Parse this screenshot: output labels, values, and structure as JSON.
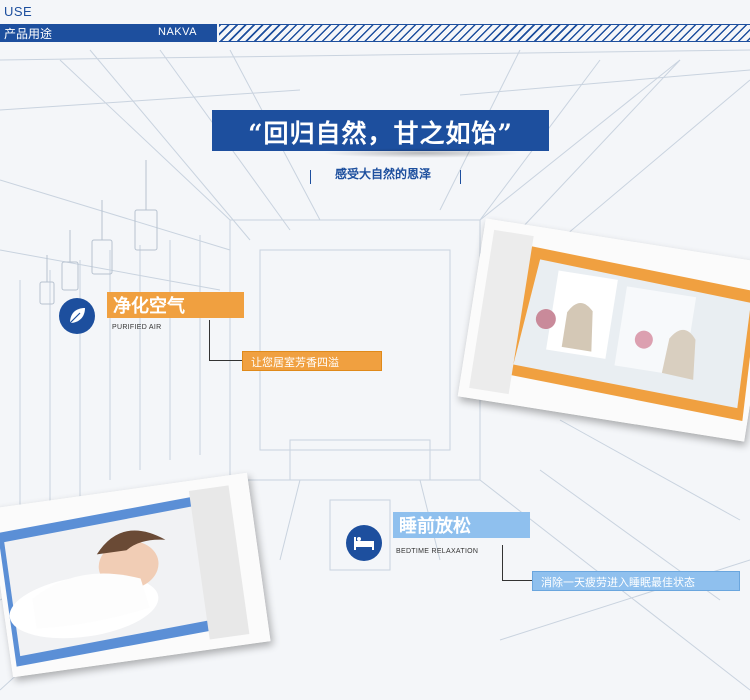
{
  "header": {
    "use_label": "USE",
    "cn_label": "产品用途",
    "brand": "NAKVA"
  },
  "slogan": {
    "text": "“回归自然，甘之如饴”",
    "subtitle": "感受大自然的恩泽"
  },
  "features": [
    {
      "title": "净化空气",
      "english": "PURIFIED AIR",
      "description": "让您居室芳香四溢",
      "icon": "leaf-icon",
      "accent": "#f0a040"
    },
    {
      "title": "睡前放松",
      "english": "BEDTIME RELAXATION",
      "description": "消除一天疲劳进入睡眠最佳状态",
      "icon": "bed-icon",
      "accent": "#8fc0ee"
    }
  ],
  "colors": {
    "brand_blue": "#1d4f9e",
    "orange": "#f0a040",
    "light_blue": "#8fc0ee"
  },
  "photos": [
    {
      "subject": "living-room-photo",
      "frame": "orange"
    },
    {
      "subject": "sleeping-woman-photo",
      "frame": "blue"
    }
  ]
}
